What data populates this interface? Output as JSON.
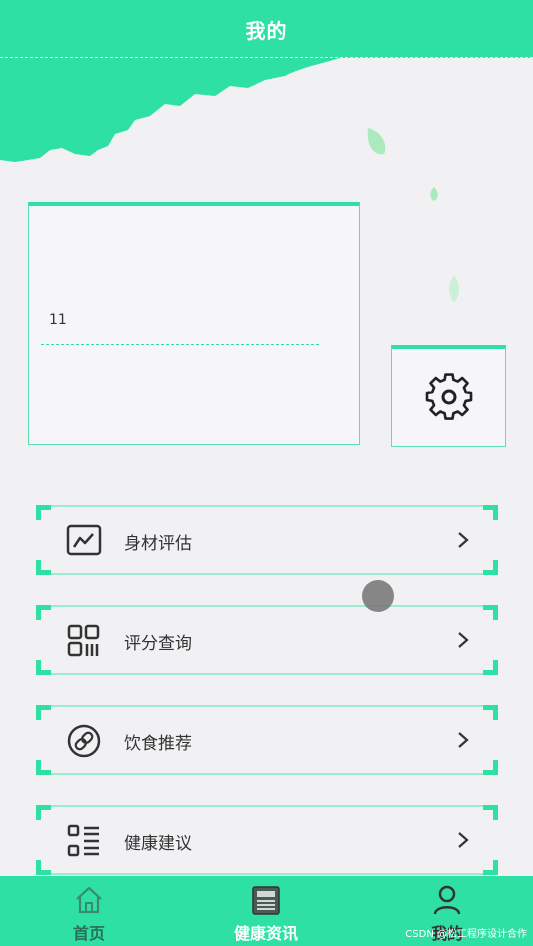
{
  "header": {
    "title": "我的"
  },
  "profile": {
    "name": "11"
  },
  "menu": [
    {
      "label": "身材评估",
      "icon": "chart-icon"
    },
    {
      "label": "评分查询",
      "icon": "grid-icon"
    },
    {
      "label": "饮食推荐",
      "icon": "link-icon"
    },
    {
      "label": "健康建议",
      "icon": "list-icon"
    }
  ],
  "tabbar": {
    "items": [
      {
        "label": "首页",
        "icon": "home-icon"
      },
      {
        "label": "健康资讯",
        "icon": "news-icon"
      },
      {
        "label": "我的",
        "icon": "user-icon"
      }
    ]
  },
  "watermark": "CSDN @松工程序设计合作",
  "colors": {
    "primary": "#2ee0a4",
    "background": "#f1f0f3",
    "text": "#333333"
  }
}
